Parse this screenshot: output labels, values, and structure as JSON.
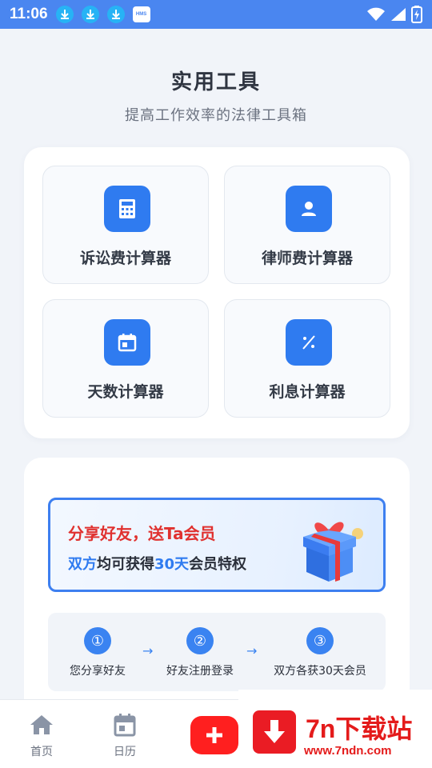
{
  "status_bar": {
    "time": "11:06",
    "hms_label": "HMS"
  },
  "header": {
    "title": "实用工具",
    "subtitle": "提高工作效率的法律工具箱"
  },
  "tools": [
    {
      "label": "诉讼费计算器",
      "icon": "calculator-icon"
    },
    {
      "label": "律师费计算器",
      "icon": "person-icon"
    },
    {
      "label": "天数计算器",
      "icon": "calendar-icon"
    },
    {
      "label": "利息计算器",
      "icon": "percent-icon"
    }
  ],
  "share": {
    "banner_title": "分享好友，送Ta会员",
    "desc_part1": "双方",
    "desc_part2": "均可获得",
    "desc_part3": "30天",
    "desc_part4": "会员特权",
    "steps": [
      {
        "num": "①",
        "label": "您分享好友"
      },
      {
        "num": "②",
        "label": "好友注册登录"
      },
      {
        "num": "③",
        "label": "双方各获30天会员"
      }
    ],
    "arrow": "→"
  },
  "bottom_nav": {
    "home_label": "首页",
    "calendar_label": "日历",
    "add_label": "+"
  },
  "watermark": {
    "title": "7n下载站",
    "url": "www.7ndn.com"
  },
  "colors": {
    "primary": "#2f7bf0",
    "accent_red": "#e0312f",
    "status_bar": "#4a86f0"
  }
}
